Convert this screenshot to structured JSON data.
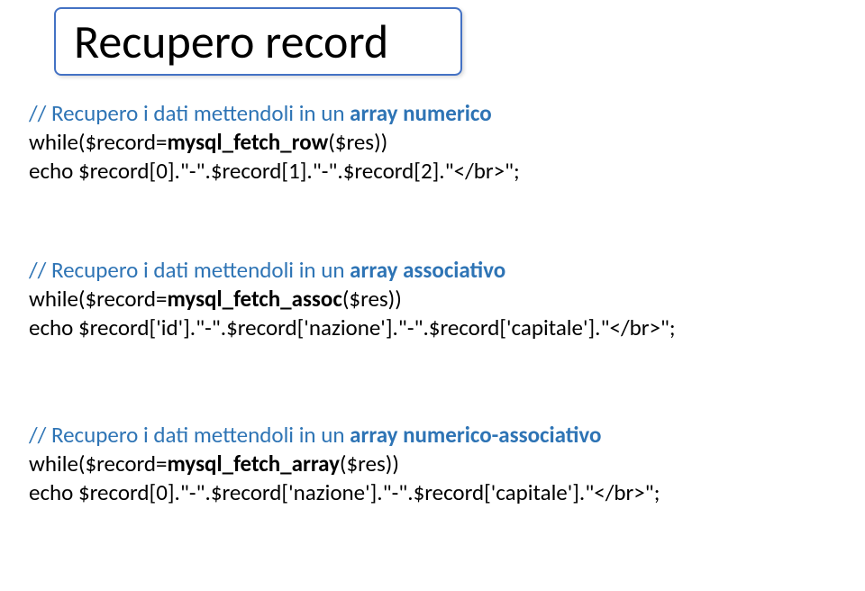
{
  "title": "Recupero record",
  "blocks": [
    {
      "comment": "// Recupero i dati mettendoli in un ",
      "comment_bold": "array numerico",
      "line2_a": "while($record=",
      "line2_b": "mysql_fetch_row",
      "line2_c": "($res))",
      "line3": "echo $record[0].\"-\".$record[1].\"-\".$record[2].\"</br>\";"
    },
    {
      "comment": "// Recupero i dati mettendoli in un ",
      "comment_bold": "array associativo",
      "line2_a": "while($record=",
      "line2_b": "mysql_fetch_assoc",
      "line2_c": "($res))",
      "line3": "echo $record['id'].\"-\".$record['nazione'].\"-\".$record['capitale'].\"</br>\";"
    },
    {
      "comment": "// Recupero i dati mettendoli in un ",
      "comment_bold": "array numerico-associativo",
      "line2_a": "while($record=",
      "line2_b": "mysql_fetch_array",
      "line2_c": "($res))",
      "line3": "echo $record[0].\"-\".$record['nazione'].\"-\".$record['capitale'].\"</br>\";"
    }
  ]
}
